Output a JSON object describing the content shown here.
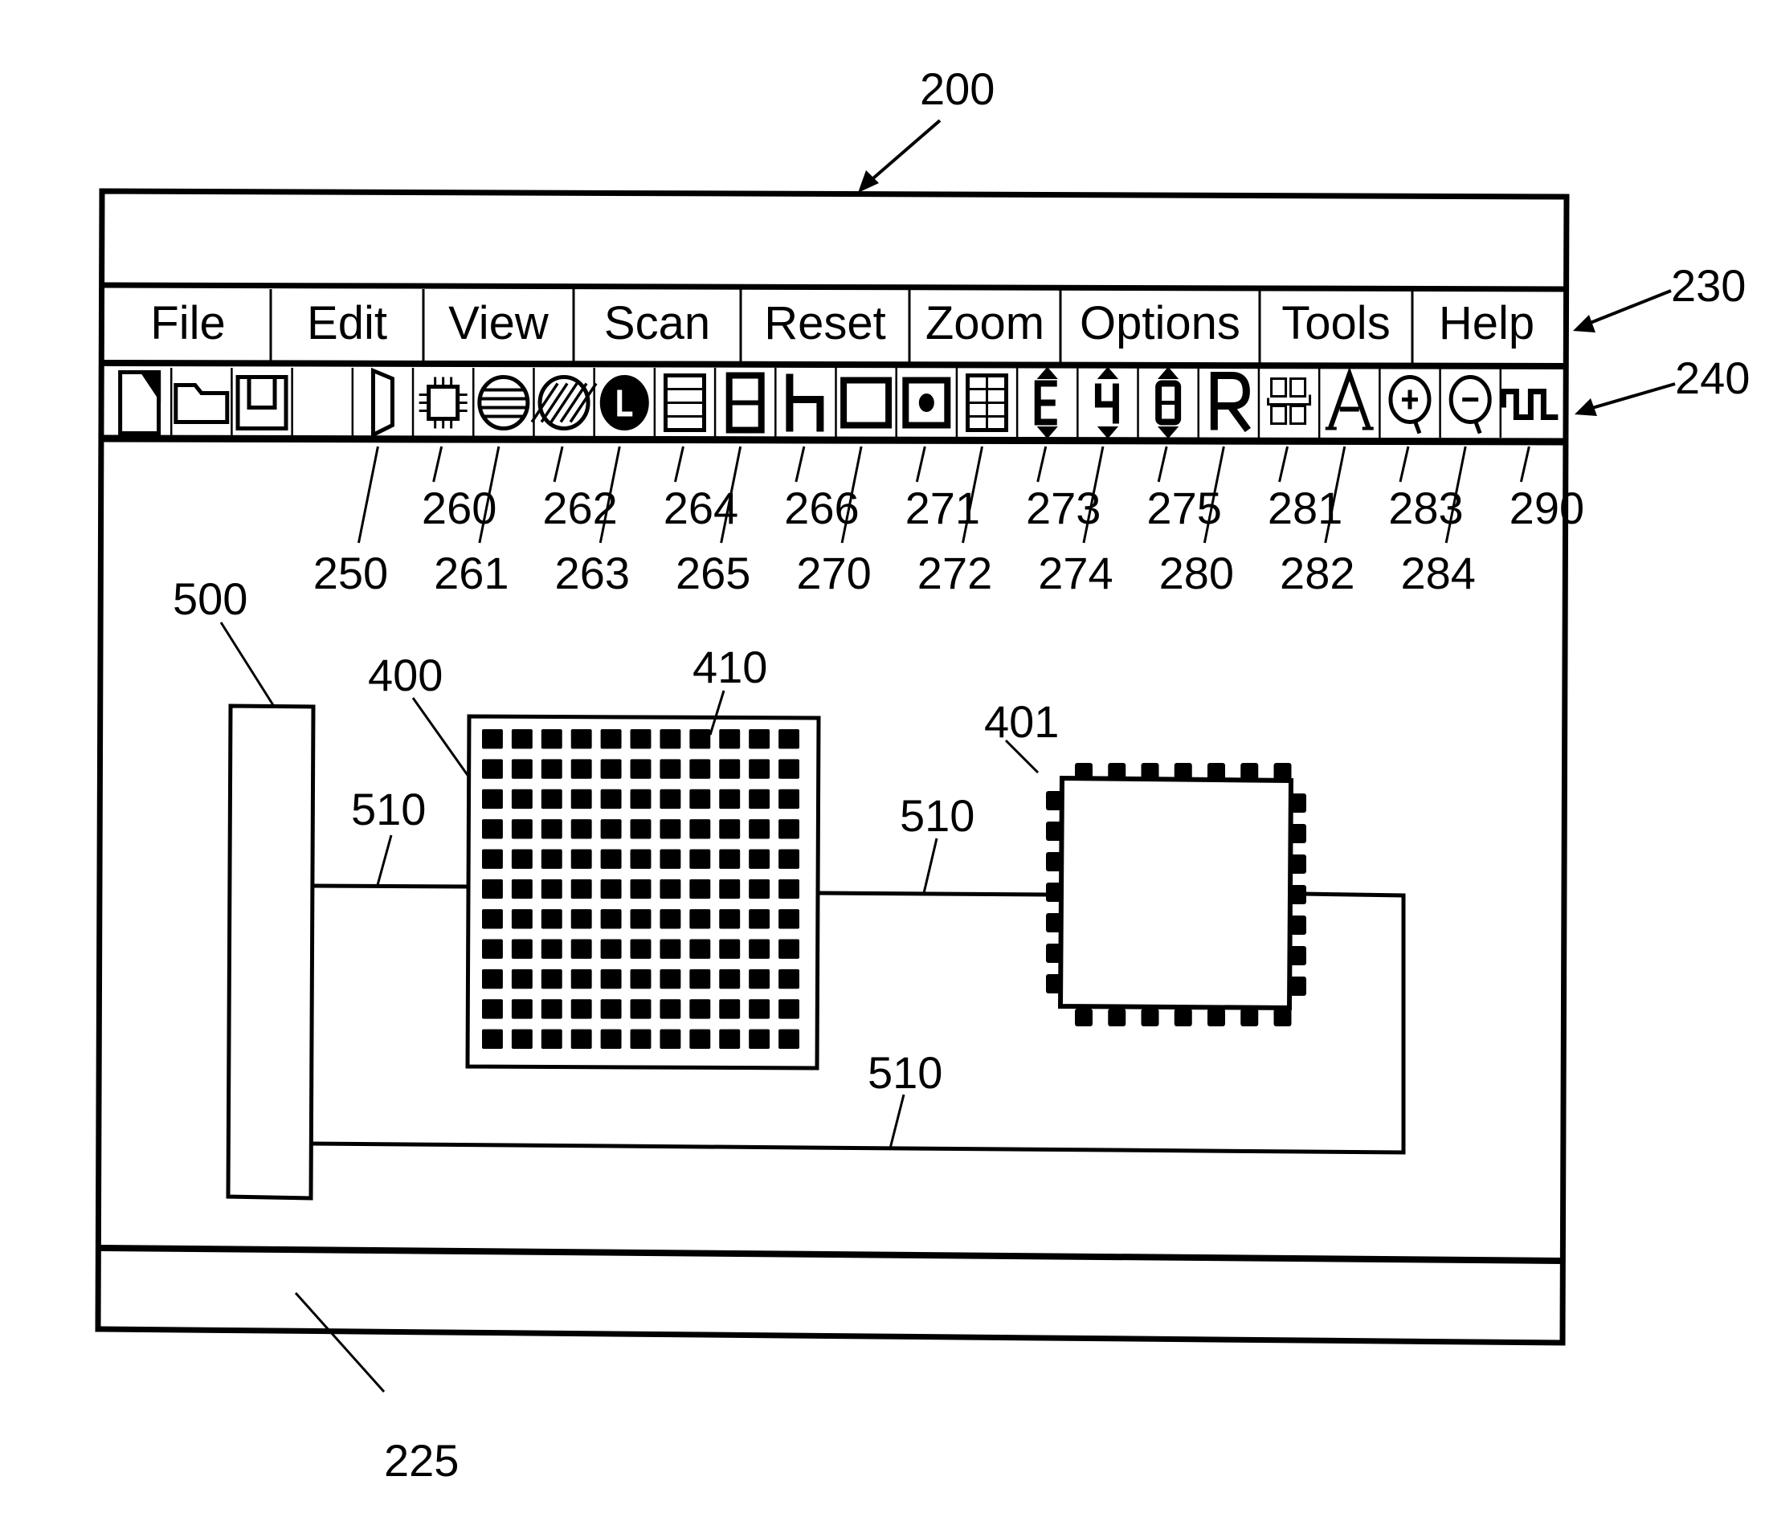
{
  "figure": {
    "window_ref": "200",
    "menubar_ref": "230",
    "toolbar_ref": "240",
    "statusbar_ref": "225"
  },
  "menubar": {
    "items": [
      {
        "label": "File"
      },
      {
        "label": "Edit"
      },
      {
        "label": "View"
      },
      {
        "label": "Scan"
      },
      {
        "label": "Reset"
      },
      {
        "label": "Zoom"
      },
      {
        "label": "Options"
      },
      {
        "label": "Tools"
      },
      {
        "label": "Help"
      }
    ]
  },
  "toolbar": {
    "buttons": [
      {
        "icon": "new-file-icon",
        "ref": ""
      },
      {
        "icon": "open-folder-icon",
        "ref": ""
      },
      {
        "icon": "save-icon",
        "ref": ""
      },
      {
        "icon": "blank-icon",
        "ref": ""
      },
      {
        "icon": "panel-icon",
        "ref": "250"
      },
      {
        "icon": "chip-icon",
        "ref": "260"
      },
      {
        "icon": "horizontal-stripes-circle-icon",
        "ref": "261"
      },
      {
        "icon": "diagonal-stripes-circle-icon",
        "ref": "262"
      },
      {
        "icon": "l-circle-icon",
        "ref": "263"
      },
      {
        "icon": "rows-icon",
        "ref": "264"
      },
      {
        "icon": "digit-eight-box-icon",
        "ref": "265"
      },
      {
        "icon": "h-glyph-icon",
        "ref": "266"
      },
      {
        "icon": "square-icon",
        "ref": "270"
      },
      {
        "icon": "square-dot-icon",
        "ref": "271"
      },
      {
        "icon": "grid-icon",
        "ref": "272"
      },
      {
        "icon": "e-updown-icon",
        "ref": "273"
      },
      {
        "icon": "four-updown-icon",
        "ref": "274"
      },
      {
        "icon": "eight-updown-icon",
        "ref": "275"
      },
      {
        "icon": "r-glyph-icon",
        "ref": "280"
      },
      {
        "icon": "group-icon",
        "ref": "281"
      },
      {
        "icon": "text-a-icon",
        "ref": "282"
      },
      {
        "icon": "zoom-in-icon",
        "ref": "283"
      },
      {
        "icon": "zoom-out-icon",
        "ref": "284"
      },
      {
        "icon": "waveform-icon",
        "ref": "290"
      }
    ]
  },
  "canvas": {
    "component_500_ref": "500",
    "component_400_ref": "400",
    "component_410_ref": "410",
    "component_401_ref": "401",
    "wire_refs": [
      "510",
      "510",
      "510"
    ],
    "grid_rows": 11,
    "grid_cols": 11,
    "chip_pins_per_side": 7
  }
}
